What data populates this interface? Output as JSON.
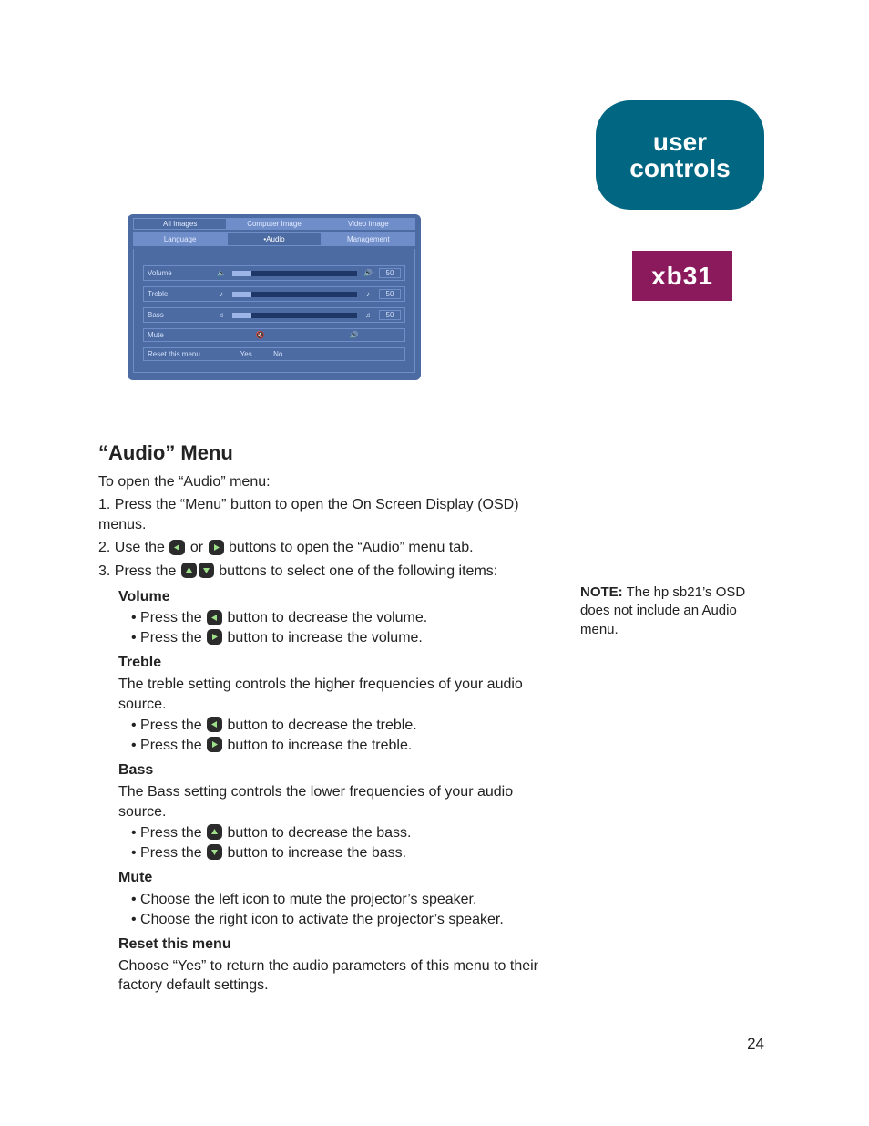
{
  "badge": {
    "line1": "user",
    "line2": "controls",
    "model": "xb31"
  },
  "osd": {
    "primary_tabs": [
      "All Images",
      "Computer Image",
      "Video Image"
    ],
    "sub_tabs": [
      "Language",
      "•Audio",
      "Management"
    ],
    "active_sub_index": 1,
    "rows": [
      {
        "label": "Volume",
        "type": "slider",
        "value": "50"
      },
      {
        "label": "Treble",
        "type": "slider",
        "value": "50"
      },
      {
        "label": "Bass",
        "type": "slider",
        "value": "50"
      },
      {
        "label": "Mute",
        "type": "toggle"
      },
      {
        "label": "Reset this menu",
        "type": "yesno",
        "yes": "Yes",
        "no": "No"
      }
    ]
  },
  "heading": "“Audio” Menu",
  "intro": "To open the “Audio” menu:",
  "steps": {
    "s1": "1. Press the “Menu” button to open the On Screen Display (OSD) menus.",
    "s2a": "2. Use the ",
    "s2b": " or ",
    "s2c": " buttons to open the “Audio” menu tab.",
    "s3a": "3. Press the ",
    "s3b": " buttons to select one of the following items:"
  },
  "sections": {
    "volume": {
      "title": "Volume",
      "dec_a": "Press the ",
      "dec_b": " button to decrease the volume.",
      "inc_a": "Press the ",
      "inc_b": " button to increase the volume."
    },
    "treble": {
      "title": "Treble",
      "desc": "The treble setting controls the higher frequencies of your audio source.",
      "dec_a": "Press the ",
      "dec_b": " button to decrease the treble.",
      "inc_a": "Press the ",
      "inc_b": " button to increase the treble."
    },
    "bass": {
      "title": "Bass",
      "desc": "The Bass setting controls the lower frequencies of your audio source.",
      "dec_a": "Press the ",
      "dec_b": " button to decrease the bass.",
      "inc_a": "Press the ",
      "inc_b": " button to increase the bass."
    },
    "mute": {
      "title": "Mute",
      "left": "Choose the left icon to mute the projector’s speaker.",
      "right": "Choose the right icon to activate the projector’s speaker."
    },
    "reset": {
      "title": "Reset this menu",
      "desc": "Choose “Yes” to return the audio parameters of this menu to their factory default settings."
    }
  },
  "note": {
    "label": "NOTE:",
    "text": " The hp sb21’s OSD does not include an Audio menu."
  },
  "page_number": "24"
}
